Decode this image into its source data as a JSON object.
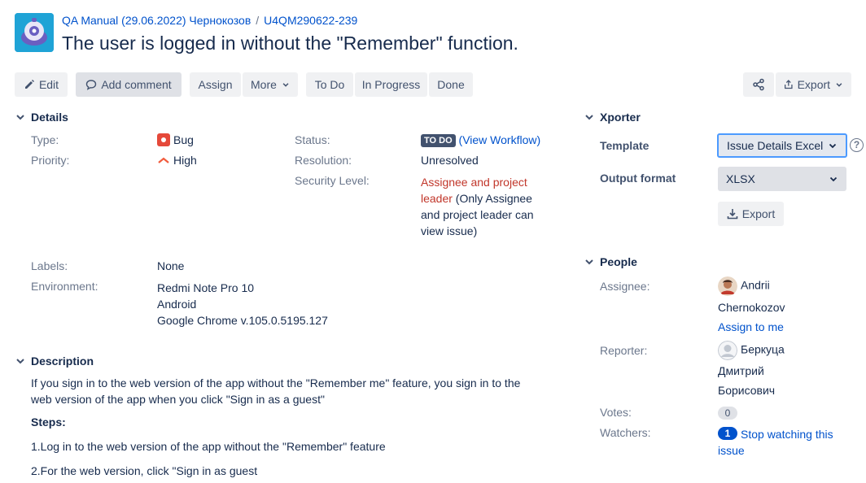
{
  "breadcrumb": {
    "project": "QA Manual (29.06.2022) Чернокозов",
    "separator": "/",
    "issue_key": "U4QM290622-239"
  },
  "title": "The user is logged in without the \"Remember\" function.",
  "toolbar": {
    "edit": "Edit",
    "add_comment": "Add comment",
    "assign": "Assign",
    "more": "More",
    "todo": "To Do",
    "in_progress": "In Progress",
    "done": "Done",
    "export": "Export"
  },
  "details": {
    "heading": "Details",
    "type_label": "Type:",
    "type_value": "Bug",
    "priority_label": "Priority:",
    "priority_value": "High",
    "status_label": "Status:",
    "status_badge": "TO DO",
    "status_workflow_open": "(",
    "status_workflow_link": "View Workflow",
    "status_workflow_close": ")",
    "resolution_label": "Resolution:",
    "resolution_value": "Unresolved",
    "security_label": "Security Level:",
    "security_value": "Assignee and project leader",
    "security_note": " (Only Assignee and project leader can view issue)",
    "labels_label": "Labels:",
    "labels_value": "None",
    "environment_label": "Environment:",
    "environment_lines": [
      "Redmi Note Pro 10",
      "Android",
      "Google Chrome v.105.0.5195.127"
    ]
  },
  "description": {
    "heading": "Description",
    "intro": "If you sign in to the web version of the app without the \"Remember me\" feature, you sign in to the web version of the app when you click \"Sign in as a guest\"",
    "steps_heading": "Steps:",
    "step1": "1.Log in to the web version of the app without the \"Remember\" feature",
    "step2": "2.For the web version, click \"Sign in as guest"
  },
  "xporter": {
    "heading": "Xporter",
    "template_label": "Template",
    "template_value": "Issue Details Excel",
    "output_label": "Output format",
    "output_value": "XLSX",
    "export_button": "Export",
    "help": "?"
  },
  "people": {
    "heading": "People",
    "assignee_label": "Assignee:",
    "assignee_first": "Andrii",
    "assignee_last": "Chernokozov",
    "assign_to_me": "Assign to me",
    "reporter_label": "Reporter:",
    "reporter_first": "Беркуца",
    "reporter_line2": "Дмитрий",
    "reporter_line3": "Борисович",
    "votes_label": "Votes:",
    "votes_count": "0",
    "watchers_label": "Watchers:",
    "watchers_count": "1",
    "stop_watching": "Stop watching this issue"
  },
  "colors": {
    "link": "#0052cc",
    "security_red": "#c1362a",
    "priority_high": "#f15b3c",
    "bug_red": "#e5493a"
  }
}
